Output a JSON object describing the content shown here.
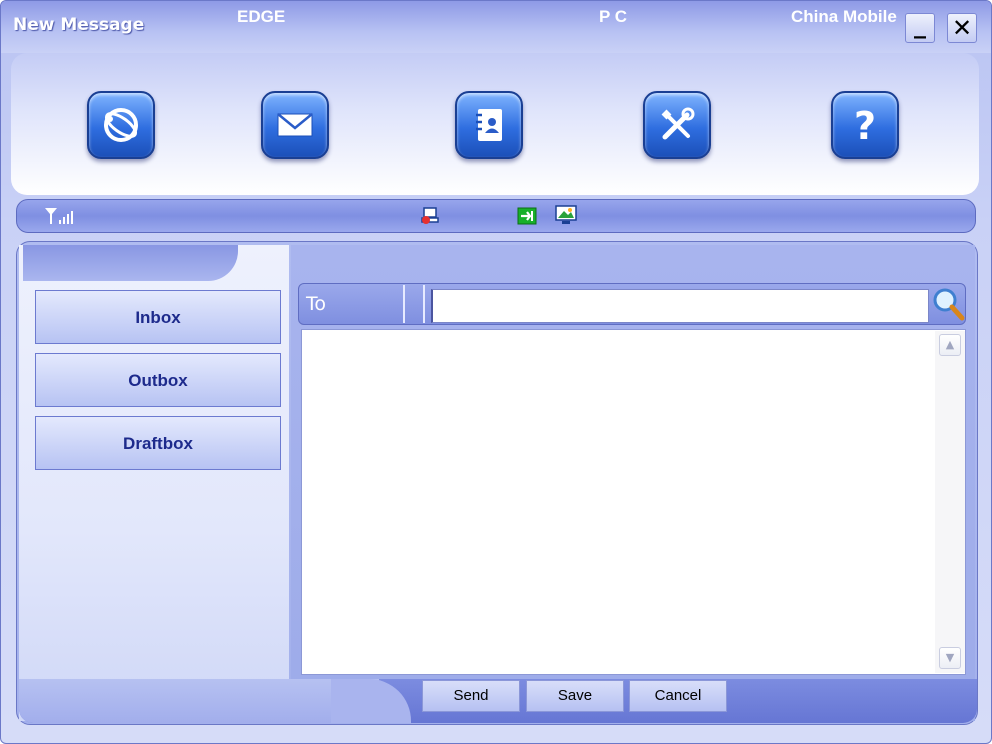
{
  "window": {
    "title": "New Message",
    "minimize_symbol": "_",
    "close_symbol": "✕"
  },
  "toolbar": {
    "items": [
      {
        "icon": "internet-globe-icon"
      },
      {
        "icon": "message-envelope-icon"
      },
      {
        "icon": "phonebook-contacts-icon"
      },
      {
        "icon": "settings-tools-icon"
      },
      {
        "icon": "help-question-icon",
        "label": "?"
      }
    ]
  },
  "status": {
    "signal_icon": "signal-strength-icon",
    "network": "EDGE",
    "connection_icon": "network-connection-icon",
    "device": "P C",
    "carrier": "China Mobile"
  },
  "sidebar": {
    "items": [
      {
        "label": "Inbox"
      },
      {
        "label": "Outbox"
      },
      {
        "label": "Draftbox"
      }
    ]
  },
  "compose": {
    "to_label": "To",
    "to_value": "",
    "body_value": ""
  },
  "actions": {
    "send": "Send",
    "save": "Save",
    "cancel": "Cancel"
  },
  "colors": {
    "accent": "#7f8fe2",
    "nav_text": "#1d2a8c",
    "icon_blue": "#2f6ee0"
  }
}
